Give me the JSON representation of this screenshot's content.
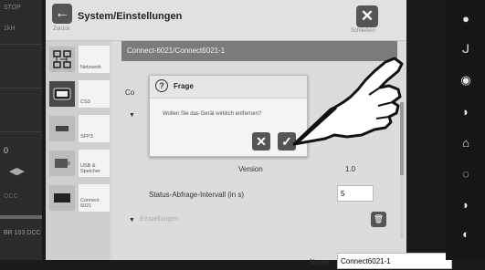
{
  "left_strip": {
    "stop_label": "STOP",
    "item_label": "1kH",
    "level_number": "0",
    "occ_label": "OCC",
    "footer_label": "BR 103 DCC"
  },
  "window": {
    "title": "System/Einstellungen",
    "back_label": "Zurück",
    "close_label": "Schließen"
  },
  "sidebar": {
    "items": [
      {
        "label": "Netzwerk",
        "icon": "network-icon"
      },
      {
        "label": "CS3",
        "icon": "cs3-device-icon"
      },
      {
        "label": "SFP3",
        "icon": "sfp-module-icon"
      },
      {
        "label": "USB & Speicher",
        "icon": "usb-storage-icon"
      },
      {
        "label": "Connect 6021",
        "icon": "connect-6021-icon"
      }
    ]
  },
  "content": {
    "path": "Connect-6021/Connect6021-1",
    "co_label": "Co",
    "version_label": "Version",
    "version_value": "1.0",
    "status_label": "Status-Abfrage-Intervall (in s)",
    "status_value": "5",
    "settings_label": "Einstellungen",
    "name_label": "Name",
    "name_value": "Connect6021-1"
  },
  "dialog": {
    "title": "Frage",
    "message": "Wollen Sie das Gerät wirklich entfernen?",
    "cancel_symbol": "✕",
    "confirm_symbol": "✓"
  },
  "right_strip": {
    "icons": [
      "light-icon",
      "crane-hook-icon",
      "locomotive-sound-icon",
      "horn-icon",
      "bell-icon",
      "radio-icon",
      "horn-2-icon",
      "headlight-icon"
    ]
  },
  "colors": {
    "path_bar": "#7b7b7b",
    "dark_button": "#555555",
    "frame": "#1a1a1a"
  }
}
